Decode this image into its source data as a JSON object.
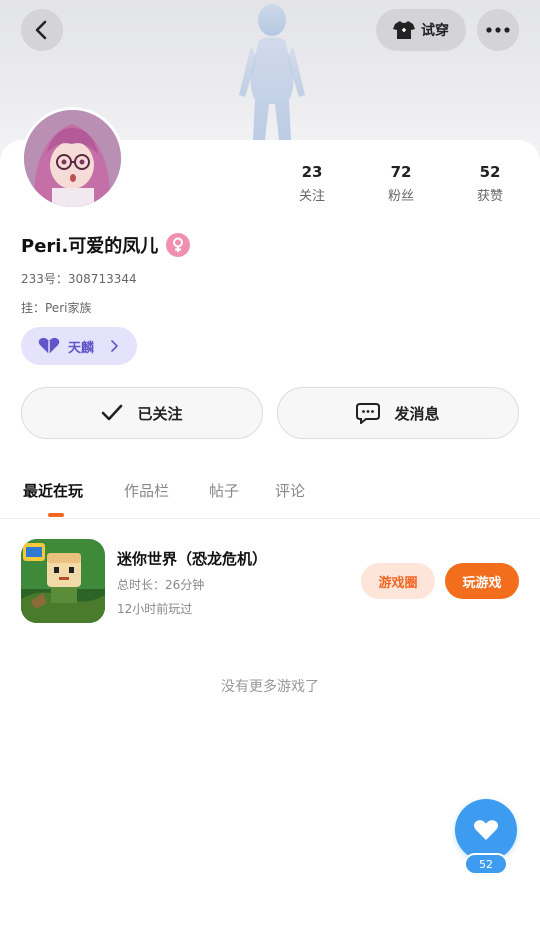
{
  "header": {
    "tryon_label": "试穿"
  },
  "profile": {
    "username": "Peri.可爱的凤儿",
    "uid": "233号：308713344",
    "clan": "挂：Peri家族",
    "level_label": "天麟",
    "stats": [
      {
        "value": "23",
        "label": "关注"
      },
      {
        "value": "72",
        "label": "粉丝"
      },
      {
        "value": "52",
        "label": "获赞"
      }
    ]
  },
  "actions": {
    "followed_label": "已关注",
    "message_label": "发消息"
  },
  "tabs": [
    {
      "label": "最近在玩",
      "active": true
    },
    {
      "label": "作品栏",
      "active": false
    },
    {
      "label": "帖子",
      "active": false
    },
    {
      "label": "评论",
      "active": false
    }
  ],
  "games": [
    {
      "title": "迷你世界（恐龙危机）",
      "duration": "总时长：26分钟",
      "last_played": "12小时前玩过",
      "circle_label": "游戏圈",
      "play_label": "玩游戏"
    }
  ],
  "footer_text": "没有更多游戏了",
  "like": {
    "count": "52"
  },
  "colors": {
    "accent_orange": "#f26e1d",
    "like_blue": "#3d9bf0",
    "level_purple": "#6055c9",
    "gender_pink": "#f08fb0"
  }
}
